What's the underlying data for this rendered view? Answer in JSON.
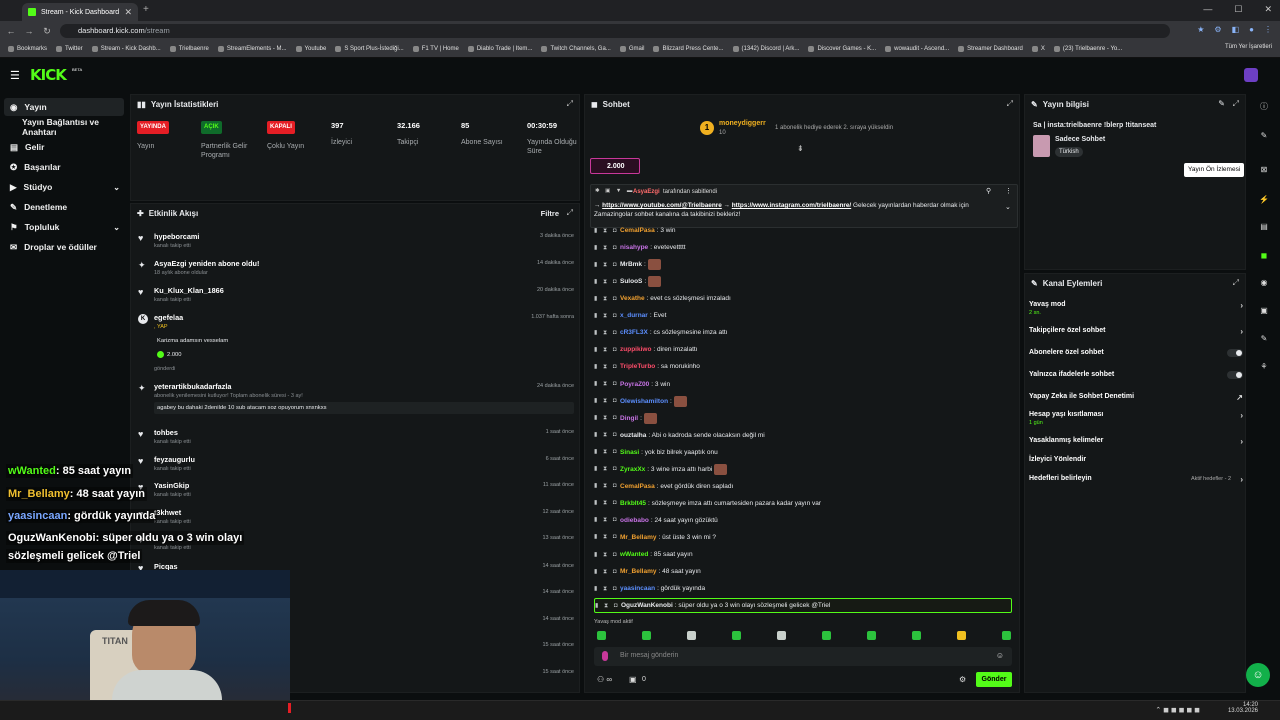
{
  "browser": {
    "tab_title": "Stream - Kick Dashboard",
    "url_host": "dashboard.kick.com",
    "url_path": "/stream",
    "bookmarks": [
      "Bookmarks",
      "Twitter",
      "Stream - Kick Dashb...",
      "Trielbaenre",
      "StreamElements - M...",
      "Youtube",
      "S Sport Plus-İstediği...",
      "F1 TV | Home",
      "Diablo Trade | Item...",
      "Twitch Channels, Ga...",
      "Gmail",
      "Blizzard Press Cente...",
      "(1342) Discord | Ark...",
      "Discover Games - K...",
      "wowaudit - Ascend...",
      "Streamer Dashboard",
      "X",
      "(23) Trielbaenre - Yo..."
    ],
    "all_bookmarks": "Tüm Yer İşaretleri"
  },
  "kick": {
    "logo": "KICK",
    "beta": "BETA"
  },
  "sidebar": {
    "items": [
      {
        "label": "Yayın",
        "icon": "broadcast-icon"
      },
      {
        "label": "Yayın Bağlantısı ve Anahtarı",
        "icon": ""
      },
      {
        "label": "Gelir",
        "icon": "money-icon"
      },
      {
        "label": "Başarılar",
        "icon": "trophy-icon"
      },
      {
        "label": "Stüdyo",
        "icon": "studio-icon"
      },
      {
        "label": "Denetleme",
        "icon": "wrench-icon"
      },
      {
        "label": "Topluluk",
        "icon": "community-icon"
      },
      {
        "label": "Droplar ve ödüller",
        "icon": "gift-icon"
      }
    ]
  },
  "stats": {
    "title": "Yayın İstatistikleri",
    "items": [
      {
        "value": "YAYINDA",
        "label": "Yayın",
        "type": "badge-red"
      },
      {
        "value": "AÇIK",
        "label": "Partnerlik Gelir Programı",
        "type": "badge-green"
      },
      {
        "value": "KAPALI",
        "label": "Çoklu Yayın",
        "type": "badge-red"
      },
      {
        "value": "397",
        "label": "İzleyici",
        "type": "num"
      },
      {
        "value": "32.166",
        "label": "Takipçi",
        "type": "num"
      },
      {
        "value": "85",
        "label": "Abone Sayısı",
        "type": "num"
      },
      {
        "value": "00:30:59",
        "label": "Yayında Olduğu Süre",
        "type": "num"
      }
    ]
  },
  "feed": {
    "title": "Etkinlik Akışı",
    "filter": "Filtre",
    "events": [
      {
        "name": "hypeborcami",
        "sub": "kanalı takip etti",
        "time": "3 dakika önce",
        "icon": "♥"
      },
      {
        "name": "AsyaEzgi yeniden abone oldu!",
        "sub": "18 aylık abone oldular",
        "time": "14 dakika önce",
        "icon": "✦"
      },
      {
        "name": "Ku_Klux_Klan_1866",
        "sub": "kanalı takip etti",
        "time": "20 dakika önce",
        "icon": "♥"
      },
      {
        "name": "egefelaa",
        "sub": ", YAP",
        "time": "1.037 hafta sonra",
        "icon": "K",
        "box": "Karizma adamsın vesselam",
        "amount": "2.000",
        "sent": "gönderdi"
      },
      {
        "name": "yeterartikbukadarfazla",
        "sub": "abonelik yenilemesini kutluyor! Toplam abonelik süresi - 3 ay!",
        "time": "24 dakika önce",
        "icon": "✦",
        "box": "agabey bu dahaki 2denilde 10 sub atacam soz opuyorum xnxnkxs"
      },
      {
        "name": "tohbes",
        "sub": "kanalı takip etti",
        "time": "1 saat önce",
        "icon": "♥"
      },
      {
        "name": "feyzaugurlu",
        "sub": "kanalı takip etti",
        "time": "6 saat önce",
        "icon": "♥"
      },
      {
        "name": "YasinGkip",
        "sub": "kanalı takip etti",
        "time": "11 saat önce",
        "icon": "♥"
      },
      {
        "name": "t3khwet",
        "sub": "kanalı takip etti",
        "time": "12 saat önce",
        "icon": "♥"
      },
      {
        "name": "",
        "sub": "kanalı takip etti",
        "time": "13 saat önce",
        "icon": "♥"
      },
      {
        "name": "Picqas",
        "sub": "",
        "time": "14 saat önce",
        "icon": "♥"
      },
      {
        "name": "",
        "sub": "",
        "time": "14 saat önce",
        "icon": ""
      },
      {
        "name": "",
        "sub": "",
        "time": "14 saat önce",
        "icon": ""
      },
      {
        "name": "",
        "sub": "",
        "time": "15 saat önce",
        "icon": ""
      },
      {
        "name": "",
        "sub": "",
        "time": "15 saat önce",
        "icon": ""
      }
    ]
  },
  "chat": {
    "title": "Sohbet",
    "gift_user": "moneydiggerr",
    "gift_count": "10",
    "gift_text": "1 abonelik hediye ederek 2. sıraya yükseldin",
    "kicks_amount": "2.000",
    "pinned_by": "AsyaEzgi",
    "pinned_label": "tarafından sabitlendi",
    "pinned_link1": "https://www.youtube.com/@Trielbaenre",
    "pinned_link2": "https://www.instagram.com/trielbaenre/",
    "pinned_text": "Gelecek yayınlardan haberdar olmak için Zamazingolar sohbet kanalına da takibinizi bekleriz!",
    "messages": [
      {
        "user": "CemalPasa",
        "color": "#f0a030",
        "text": ": 3 win"
      },
      {
        "user": "nisahype",
        "color": "#c873e6",
        "text": ": evetevettttt"
      },
      {
        "user": "MrBmk",
        "color": "#e8eaed",
        "text": ":",
        "emote": true
      },
      {
        "user": "SulooS",
        "color": "#e8eaed",
        "text": ":",
        "emote": true
      },
      {
        "user": "Vexathe",
        "color": "#f0a030",
        "text": ": evet cs sözleşmesi imzaladı"
      },
      {
        "user": "x_durnar",
        "color": "#5c8fff",
        "text": ": Evet"
      },
      {
        "user": "cR3FL3X",
        "color": "#5c8fff",
        "text": ": cs sözleşmesine imza attı"
      },
      {
        "user": "zuppikiwo",
        "color": "#ff4d6a",
        "text": ": diren imzalattı"
      },
      {
        "user": "TripleTurbo",
        "color": "#ff4d6a",
        "text": ": sa morukinho"
      },
      {
        "user": "PoyraZ00",
        "color": "#c873e6",
        "text": ": 3 win"
      },
      {
        "user": "Olewishamilton",
        "color": "#5c8fff",
        "text": ":",
        "emote": true
      },
      {
        "user": "Dingil",
        "color": "#c873e6",
        "text": ":",
        "emote": true
      },
      {
        "user": "ouztalha",
        "color": "#e8eaed",
        "text": ": Abi o kadroda sende olacaksın değil mi"
      },
      {
        "user": "Sinasi",
        "color": "#53fc18",
        "text": ": yok biz bilrek yaaptık onu"
      },
      {
        "user": "ZyraxXx",
        "color": "#53fc18",
        "text": ": 3 wine imza attı harbi",
        "emote": true
      },
      {
        "user": "CemalPasa",
        "color": "#f0a030",
        "text": ": evet gördük diren sapladı"
      },
      {
        "user": "Brkblt45",
        "color": "#53fc18",
        "text": ": sözleşmeye imza attı cumartesiden pazara kadar yayın var"
      },
      {
        "user": "odiebabo",
        "color": "#c873e6",
        "text": ": 24 saat yayın gözüktü"
      },
      {
        "user": "Mr_Bellamy",
        "color": "#f0a030",
        "text": ": üst üste 3 win mi ?"
      },
      {
        "user": "wWanted",
        "color": "#53fc18",
        "text": ": 85 saat yayın"
      },
      {
        "user": "Mr_Bellamy",
        "color": "#f0a030",
        "text": ": 48 saat yayın"
      },
      {
        "user": "yaasincaan",
        "color": "#5c8fff",
        "text": ": gördük yayında"
      },
      {
        "user": "OguzWanKenobi",
        "color": "#e8eaed",
        "text": ": süper oldu ya o 3 win olayı sözleşmeli gelicek @Triel"
      }
    ],
    "slow_mode": "Yavaş mod aktif",
    "input_placeholder": "Bir mesaj gönderin",
    "send": "Gönder",
    "gift_counter": "0"
  },
  "stream_info": {
    "title": "Yayın bilgisi",
    "stream_title": "Sa | insta:trielbaenre !blerp !titanseat",
    "category": "Sadece Sohbet",
    "language": "Türkish",
    "tooltip": "Yayın Ön İzlemesi"
  },
  "channel_actions": {
    "title": "Kanal Eylemleri",
    "items": [
      {
        "label": "Yavaş mod",
        "sub": "2 sn.",
        "ctl": "arrow"
      },
      {
        "label": "Takipçilere özel sohbet",
        "sub": "",
        "ctl": "arrow"
      },
      {
        "label": "Abonelere özel sohbet",
        "sub": "",
        "ctl": "toggle"
      },
      {
        "label": "Yalnızca ifadelerle sohbet",
        "sub": "",
        "ctl": "toggle"
      },
      {
        "label": "Yapay Zeka ile Sohbet Denetimi",
        "sub": "",
        "ctl": "ext"
      },
      {
        "label": "Hesap yaşı kısıtlaması",
        "sub": "1 gün",
        "ctl": "arrow"
      },
      {
        "label": "Yasaklanmış kelimeler",
        "sub": "",
        "ctl": "arrow"
      },
      {
        "label": "İzleyici Yönlendir",
        "sub": "",
        "ctl": ""
      },
      {
        "label": "Hedefleri belirleyin",
        "sub": "",
        "ctl": "arrow",
        "right": "Aktif hedefler - 2"
      }
    ]
  },
  "overlay": {
    "lines": [
      {
        "user": "wWanted",
        "text": ": 85 saat yayın",
        "color": "#53fc18"
      },
      {
        "user": "Mr_Bellamy",
        "text": ": 48 saat yayın",
        "color": "#f0c030"
      },
      {
        "user": "yaasincaan",
        "text": ": gördük yayında",
        "color": "#7aa7ff"
      },
      {
        "user": "OguzWanKenobi",
        "text": ": süper oldu ya o 3 win olayı",
        "color": "#ffffff"
      },
      {
        "user": "",
        "text": "sözleşmeli gelicek @Triel",
        "color": "#ffffff"
      }
    ],
    "chair_brand": "TITAN"
  },
  "taskbar": {
    "time": "14:20",
    "date": "13.03.2026"
  }
}
